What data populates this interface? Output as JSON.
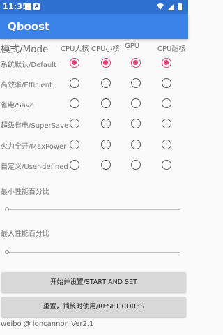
{
  "status": {
    "time": "11:35",
    "notif_icons": [
      "square-icon",
      "a-box-icon"
    ],
    "right_icons": [
      "wifi-icon",
      "signal-icon",
      "battery-icon"
    ]
  },
  "app": {
    "title": "Qboost",
    "accent": "#3b82e8",
    "status_color": "#2f6fd0",
    "radio_color": "#e0457b"
  },
  "table": {
    "mode_header": "模式/Mode",
    "columns": [
      "CPU大核",
      "CPU小核",
      "GPU",
      "CPU超核"
    ],
    "rows": [
      {
        "label": "系统默认/Default",
        "selected": [
          true,
          true,
          true,
          true
        ]
      },
      {
        "label": "高效率/Efficient",
        "selected": [
          false,
          false,
          false,
          false
        ]
      },
      {
        "label": "省电/Save",
        "selected": [
          false,
          false,
          false,
          false
        ]
      },
      {
        "label": "超级省电/SuperSave",
        "selected": [
          false,
          false,
          false,
          false
        ]
      },
      {
        "label": "火力全开/MaxPower",
        "selected": [
          false,
          false,
          false,
          false
        ]
      },
      {
        "label": "自定义/User-defined",
        "selected": [
          false,
          false,
          false,
          false
        ]
      }
    ]
  },
  "min_perf": {
    "label": "最小性能百分比",
    "value": 0
  },
  "max_perf": {
    "label": "最大性能百分比",
    "value": 0
  },
  "buttons": {
    "start": "开始并设置/START AND SET",
    "reset": "重置，锁核时使用/RESET CORES"
  },
  "footer": "weibo @ ioncannon Ver2.1"
}
